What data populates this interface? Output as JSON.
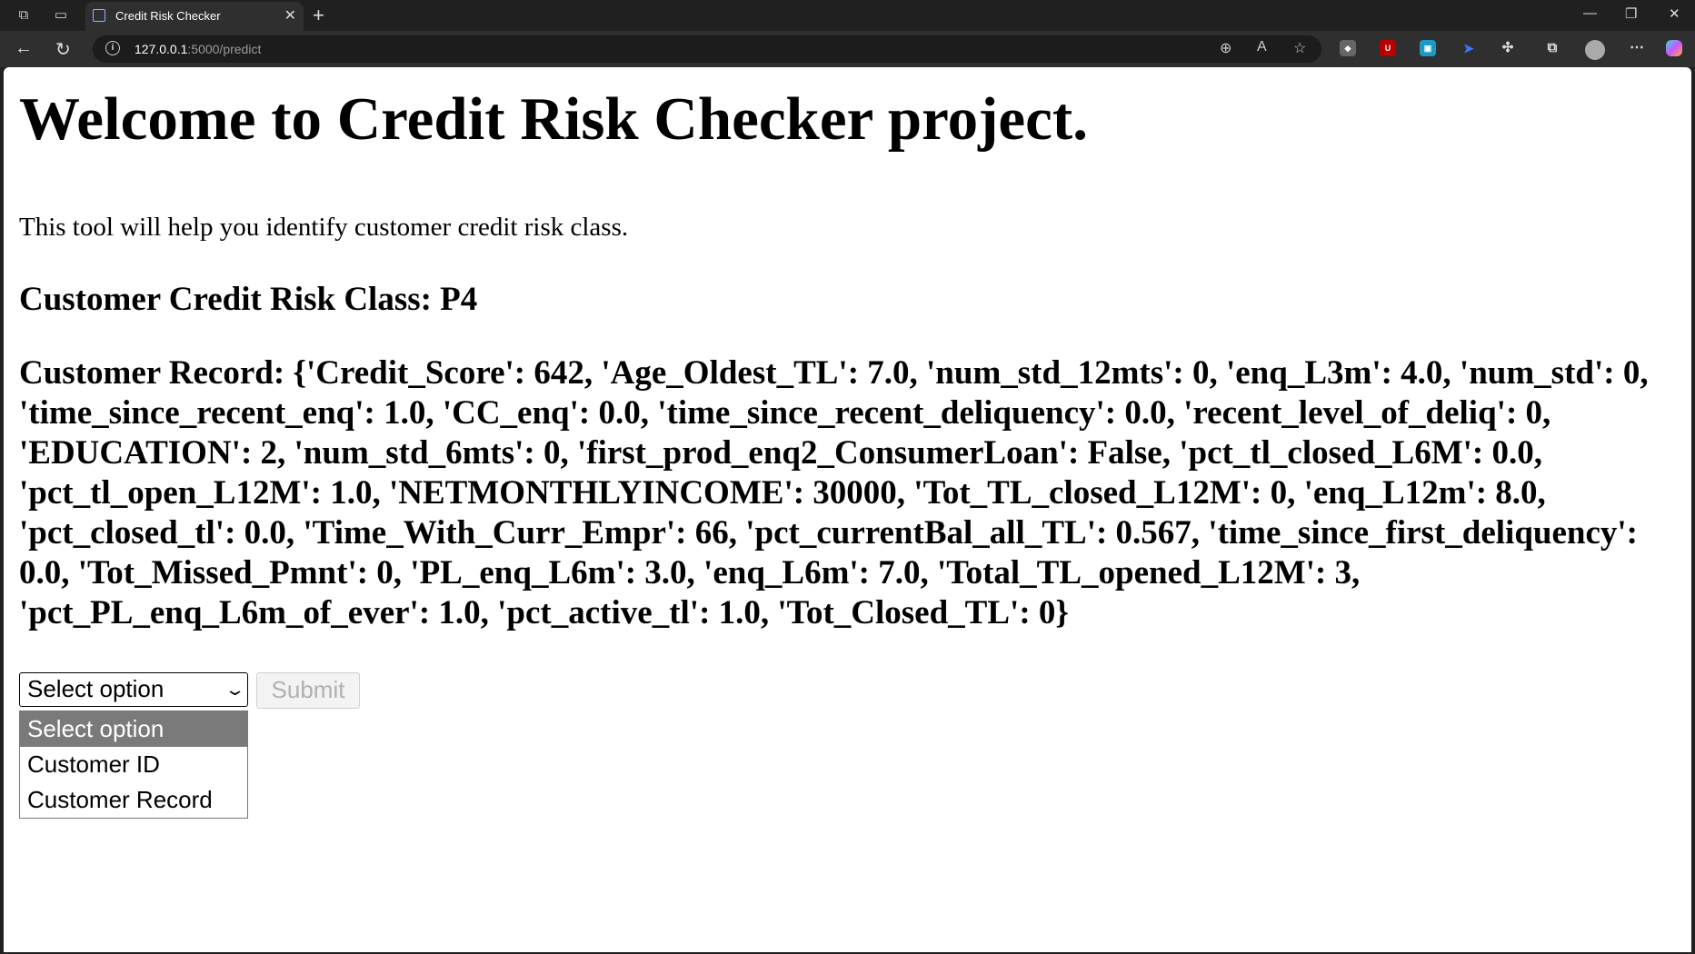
{
  "browser": {
    "tab_title": "Credit Risk Checker",
    "url_host": "127.0.0.1",
    "url_path": ":5000/predict"
  },
  "page": {
    "heading": "Welcome to Credit Risk Checker project.",
    "intro": "This tool will help you identify customer credit risk class.",
    "result": "Customer Credit Risk Class: P4",
    "record": "Customer Record: {'Credit_Score': 642, 'Age_Oldest_TL': 7.0, 'num_std_12mts': 0, 'enq_L3m': 4.0, 'num_std': 0, 'time_since_recent_enq': 1.0, 'CC_enq': 0.0, 'time_since_recent_deliquency': 0.0, 'recent_level_of_deliq': 0, 'EDUCATION': 2, 'num_std_6mts': 0, 'first_prod_enq2_ConsumerLoan': False, 'pct_tl_closed_L6M': 0.0, 'pct_tl_open_L12M': 1.0, 'NETMONTHLYINCOME': 30000, 'Tot_TL_closed_L12M': 0, 'enq_L12m': 8.0, 'pct_closed_tl': 0.0, 'Time_With_Curr_Empr': 66, 'pct_currentBal_all_TL': 0.567, 'time_since_first_deliquency': 0.0, 'Tot_Missed_Pmnt': 0, 'PL_enq_L6m': 3.0, 'enq_L6m': 7.0, 'Total_TL_opened_L12M': 3, 'pct_PL_enq_L6m_of_ever': 1.0, 'pct_active_tl': 1.0, 'Tot_Closed_TL': 0}",
    "select_value": "Select option",
    "submit_label": "Submit",
    "options": [
      "Select option",
      "Customer ID",
      "Customer Record"
    ]
  }
}
